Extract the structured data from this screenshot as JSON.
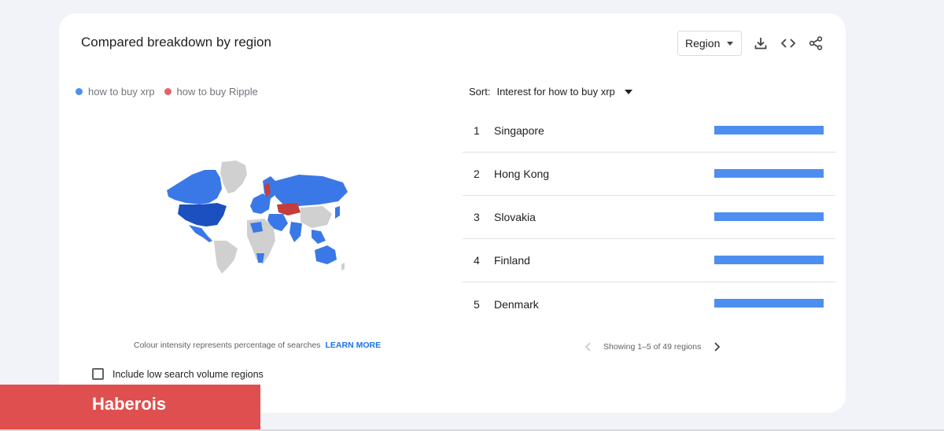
{
  "card": {
    "title": "Compared breakdown by region",
    "region_select": "Region",
    "icons": [
      "download-icon",
      "embed-code-icon",
      "share-icon"
    ]
  },
  "legend": [
    {
      "label": "how to buy xrp",
      "color": "#4d8ef0"
    },
    {
      "label": "how to buy Ripple",
      "color": "#e06666"
    }
  ],
  "map": {
    "caption": "Colour intensity represents percentage of searches",
    "learn_more": "LEARN MORE",
    "colors": {
      "term1": "#3b78e7",
      "term2": "#c53c3c",
      "no_data": "#d0d0d0"
    }
  },
  "checkbox": {
    "label": "Include low search volume regions",
    "checked": false
  },
  "sort": {
    "label": "Sort:",
    "value": "Interest for how to buy xrp"
  },
  "regions": [
    {
      "rank": "1",
      "name": "Singapore",
      "value": 100
    },
    {
      "rank": "2",
      "name": "Hong Kong",
      "value": 100
    },
    {
      "rank": "3",
      "name": "Slovakia",
      "value": 100
    },
    {
      "rank": "4",
      "name": "Finland",
      "value": 100
    },
    {
      "rank": "5",
      "name": "Denmark",
      "value": 100
    }
  ],
  "pager": {
    "text": "Showing 1–5 of 49 regions"
  },
  "brand": {
    "label": "Haberois"
  }
}
